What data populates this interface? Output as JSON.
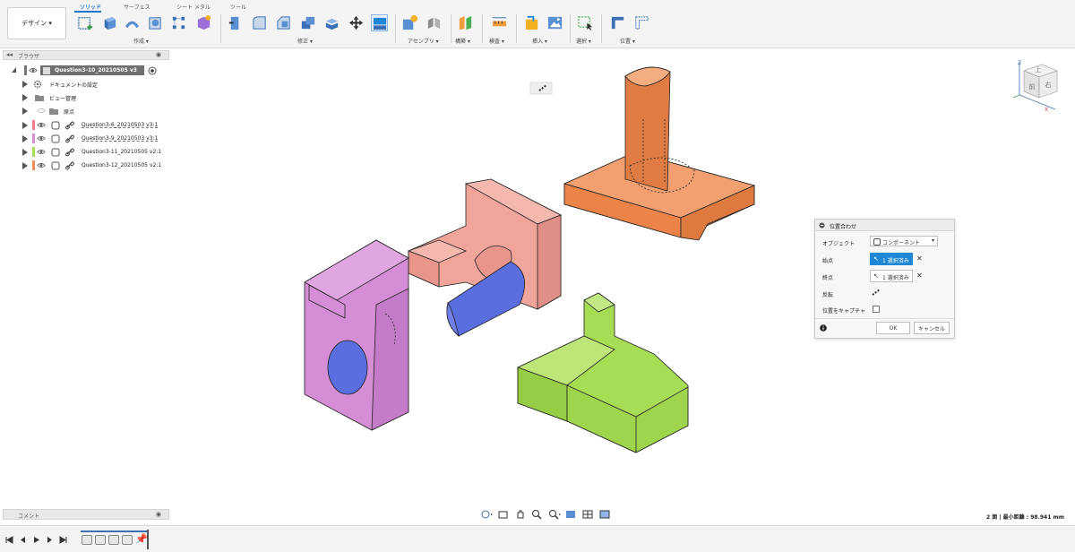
{
  "toolbar": {
    "workspace_label": "デザイン ▾",
    "tabs": [
      "ソリッド",
      "サーフェス",
      "シート メタル",
      "ツール"
    ],
    "groups": {
      "create": "作成 ▾",
      "modify": "修正 ▾",
      "assemble": "アセンブリ ▾",
      "construct": "構築 ▾",
      "inspect": "検査 ▾",
      "insert": "挿入 ▾",
      "select": "選択 ▾",
      "position": "位置 ▾"
    }
  },
  "browser": {
    "title": "ブラウザ",
    "root_label": "Question3-10_20210505 v3",
    "items": [
      {
        "label": "ドキュメントの設定"
      },
      {
        "label": "ビュー管理"
      },
      {
        "label": "原点"
      },
      {
        "label": "Question3-6_20210503 v3:1"
      },
      {
        "label": "Question3-9_20210503 v3:1"
      },
      {
        "label": "Question3-11_20210505 v2:1"
      },
      {
        "label": "Question3-12_20210505 v2:1"
      }
    ],
    "colors": [
      "#ef7a8f",
      "#d58ed6",
      "#a7dc55",
      "#f0915a"
    ]
  },
  "comments": {
    "title": "コメント"
  },
  "dialog": {
    "title": "位置合わせ",
    "object_label": "オブジェクト",
    "object_value": "コンポーネント",
    "from_label": "始点",
    "from_value": "1 選択済み",
    "to_label": "終点",
    "to_value": "1 選択済み",
    "flip_label": "反転",
    "capture_label": "位置をキャプチャ",
    "ok_label": "OK",
    "cancel_label": "キャンセル"
  },
  "viewcube": {
    "top_face": "上",
    "front_face": "前",
    "right_face": "右",
    "z_axis": "Z",
    "x_axis": "X"
  },
  "status": {
    "text": "2 面 | 最小距離 : 98.941 mm"
  },
  "colors": {
    "accent": "#1f88d6",
    "orange": "#f0915a",
    "salmon": "#f0a49a",
    "pink": "#d58ed6",
    "green": "#a7dc55",
    "blue": "#5b6ee0"
  }
}
